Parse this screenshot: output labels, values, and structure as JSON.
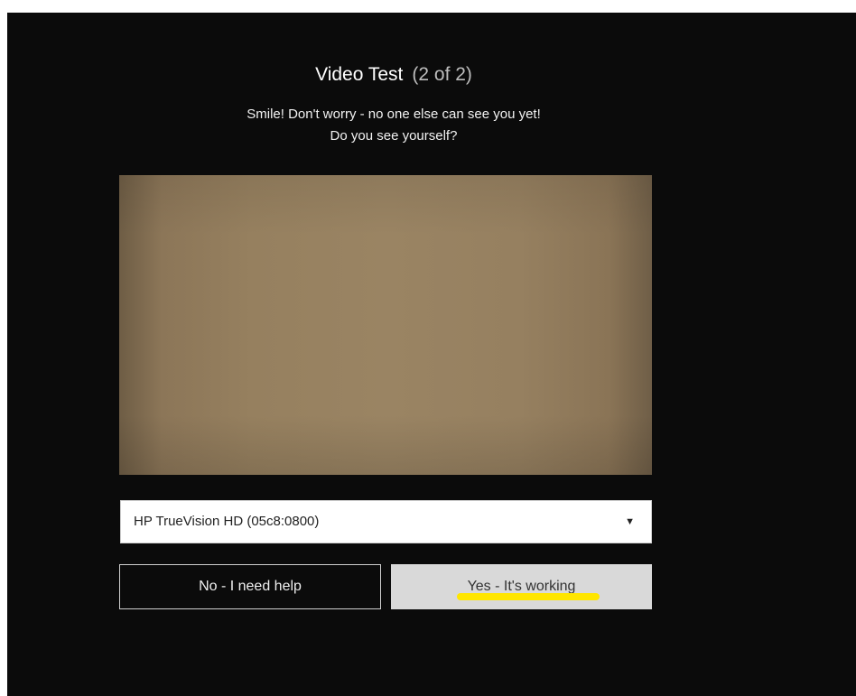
{
  "dialog": {
    "title": "Video Test",
    "step": "(2 of 2)",
    "line1": "Smile! Don't worry - no one else can see you yet!",
    "line2": "Do you see yourself?"
  },
  "camera_select": {
    "selected": "HP TrueVision HD (05c8:0800)",
    "arrow_icon": "caret-down-icon",
    "arrow_glyph": "▼"
  },
  "buttons": {
    "no_label": "No - I need help",
    "yes_label": "Yes - It's working"
  },
  "colors": {
    "background": "#0b0b0b",
    "yes_button": "#d9d9d9",
    "highlight": "#ffe600"
  }
}
